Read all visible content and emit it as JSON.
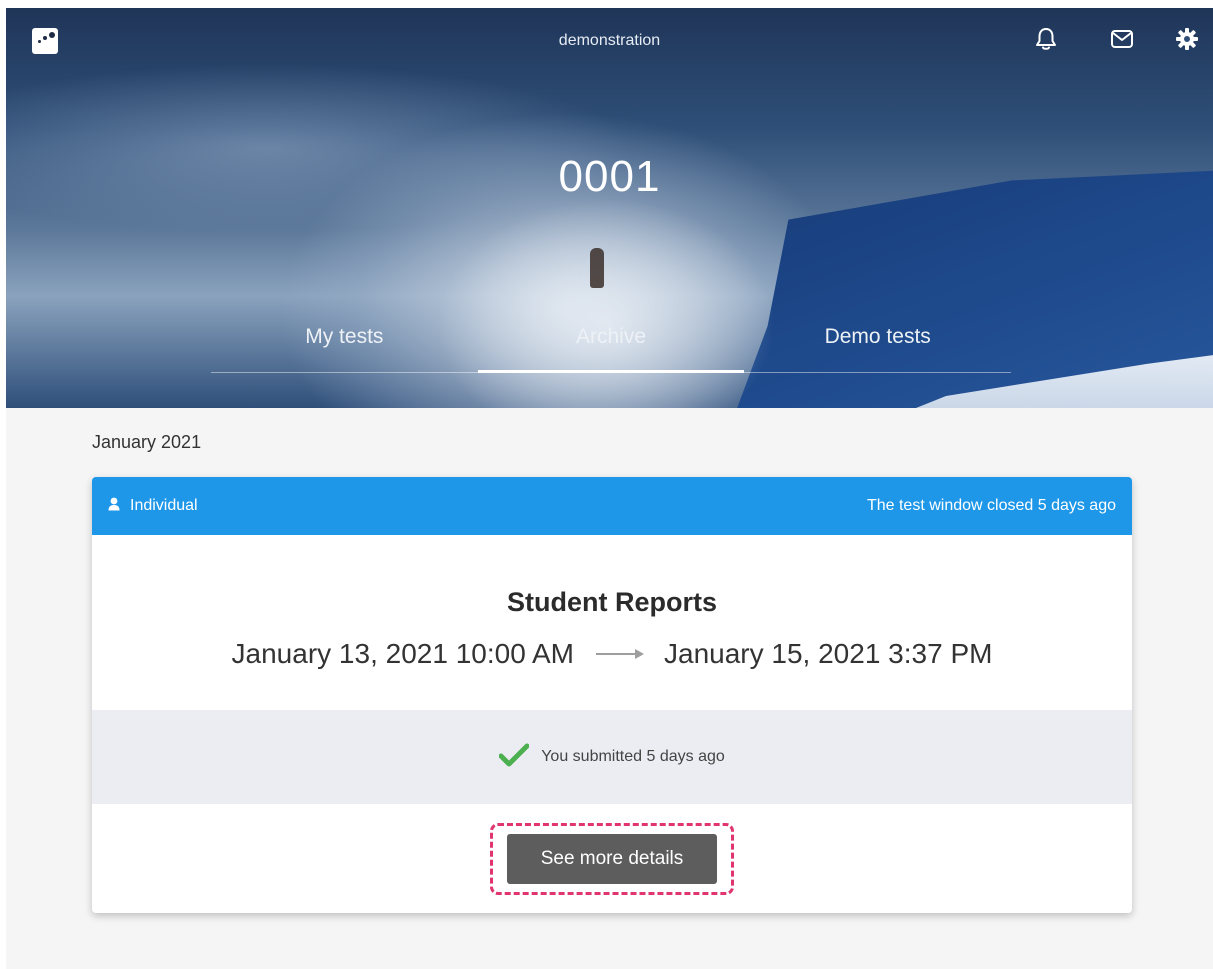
{
  "header": {
    "site_name": "demonstration",
    "test_code": "0001",
    "icons": {
      "logo": "logo-icon",
      "notifications": "bell-icon",
      "messages": "mail-icon",
      "settings": "gear-icon"
    }
  },
  "tabs": [
    {
      "label": "My tests",
      "active": false
    },
    {
      "label": "Archive",
      "active": true
    },
    {
      "label": "Demo tests",
      "active": false
    }
  ],
  "archive": {
    "month": "January 2021",
    "card": {
      "type_label": "Individual",
      "type_icon": "user-icon",
      "window_status": "The test window closed 5 days ago",
      "title": "Student Reports",
      "start": "January 13, 2021 10:00 AM",
      "end": "January 15, 2021 3:37 PM",
      "submission": "You submitted 5 days ago",
      "submission_icon": "checkmark-icon",
      "details_button": "See more details"
    }
  },
  "colors": {
    "card_header": "#1e97e8",
    "check": "#4caf50",
    "highlight": "#e0356f",
    "button": "#5d5d5d"
  }
}
